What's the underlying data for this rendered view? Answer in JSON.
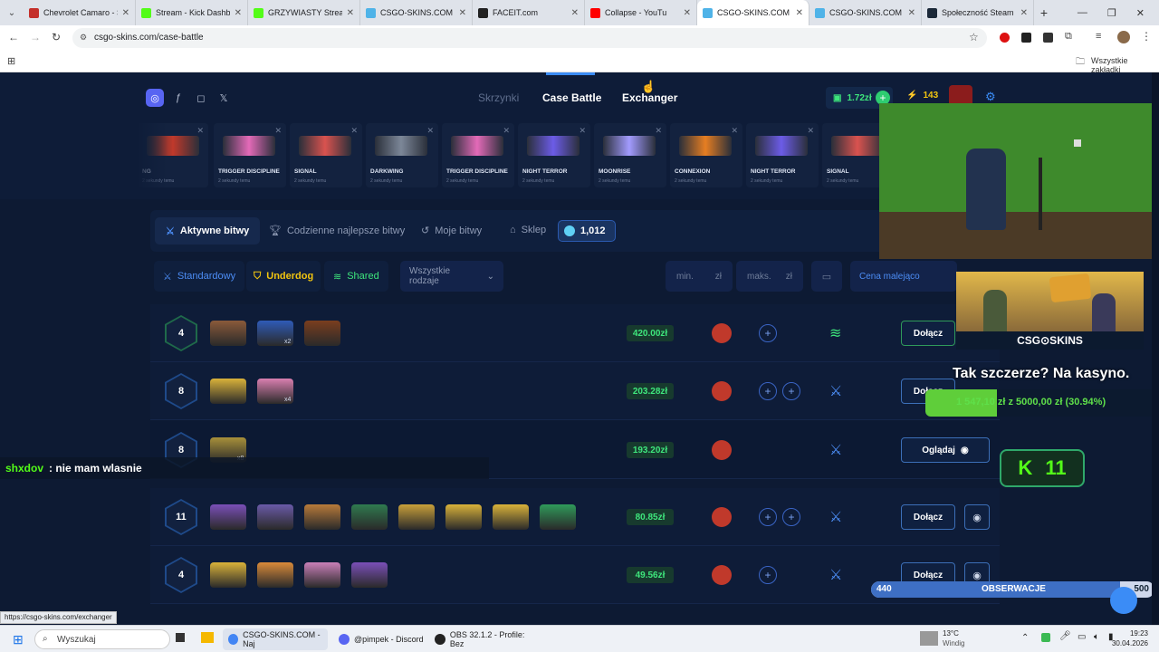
{
  "browser": {
    "tabs": [
      {
        "title": "Chevrolet Camaro - S",
        "color": "#c4302b"
      },
      {
        "title": "Stream - Kick Dashbo",
        "color": "#53fc18"
      },
      {
        "title": "GRZYWIASTY Stream",
        "color": "#53fc18"
      },
      {
        "title": "CSGO-SKINS.COM - I",
        "color": "#4fb3e8"
      },
      {
        "title": "FACEIT.com",
        "color": "#222222"
      },
      {
        "title": "Collapse - YouTu",
        "color": "#ff0000"
      },
      {
        "title": "CSGO-SKINS.COM - I",
        "color": "#4fb3e8"
      },
      {
        "title": "CSGO-SKINS.COM - I",
        "color": "#4fb3e8"
      },
      {
        "title": "Społeczność Steam",
        "color": "#1b2838"
      }
    ],
    "url": "csgo-skins.com/case-battle",
    "bookmarks_label": "Wszystkie zakładki",
    "status_url": "https://csgo-skins.com/exchanger"
  },
  "nav": {
    "links": [
      "Skrzynki",
      "Case Battle",
      "Exchanger"
    ],
    "balance": "1.72zł",
    "level": "143"
  },
  "drops": [
    {
      "name": "NG",
      "time": "2 sekundy temu",
      "color": "#c0392b"
    },
    {
      "name": "TRIGGER DISCIPLINE",
      "time": "2 sekundy temu",
      "color": "#e36ab8"
    },
    {
      "name": "SIGNAL",
      "time": "2 sekundy temu",
      "color": "#d9534f"
    },
    {
      "name": "DARKWING",
      "time": "2 sekundy temu",
      "color": "#7c8798"
    },
    {
      "name": "TRIGGER DISCIPLINE",
      "time": "2 sekundy temu",
      "color": "#e36ab8"
    },
    {
      "name": "NIGHT TERROR",
      "time": "2 sekundy temu",
      "color": "#6c5ce7"
    },
    {
      "name": "MOONRISE",
      "time": "2 sekundy temu",
      "color": "#a29bfe"
    },
    {
      "name": "CONNEXION",
      "time": "2 sekundy temu",
      "color": "#e67e22"
    },
    {
      "name": "NIGHT TERROR",
      "time": "2 sekundy temu",
      "color": "#6c5ce7"
    },
    {
      "name": "SIGNAL",
      "time": "2 sekundy temu",
      "color": "#d9534f"
    }
  ],
  "tabs": {
    "active": "Aktywne bitwy",
    "daily": "Codzienne najlepsze bitwy",
    "mine": "Moje bitwy",
    "shop": "Sklep",
    "coins": "1,012"
  },
  "filters": {
    "standard": "Standardowy",
    "underdog": "Underdog",
    "shared": "Shared",
    "all_types": "Wszystkie rodzaje",
    "min": "min.",
    "max": "maks.",
    "currency": "zł",
    "sort": "Cena malejąco"
  },
  "battles": [
    {
      "rounds": "4",
      "price": "420.00zł",
      "action": "Dołącz",
      "cases": [
        "#8a5a3a",
        "#2f5bb8",
        "#7a3e1e"
      ],
      "mult": "x2"
    },
    {
      "rounds": "8",
      "price": "203.28zł",
      "action": "Dołącz",
      "cases": [
        "#d9b23a",
        "#d97fb0"
      ],
      "mult": "x4"
    },
    {
      "rounds": "8",
      "price": "193.20zł",
      "action": "Oglądaj",
      "cases": [
        "#a8903a"
      ],
      "mult": "x8"
    },
    {
      "rounds": "11",
      "price": "80.85zł",
      "action": "Dołącz",
      "cases": [
        "#7a4fb8",
        "#6a5aa8",
        "#b87a3a",
        "#2f7a4f",
        "#c9a03a",
        "#d9b23a",
        "#d9b23a",
        "#2f9a5a"
      ],
      "mult": ""
    },
    {
      "rounds": "4",
      "price": "49.56zł",
      "action": "Dołącz",
      "cases": [
        "#d9b23a",
        "#d98a3a",
        "#c97fb8",
        "#7a4fb8"
      ],
      "mult": ""
    }
  ],
  "overlay": {
    "chat_user": "shxdov",
    "chat_msg": ": nie mam wlasnie",
    "brand": "CSG⊙SKINS",
    "headline": "Tak szczerze? Na kasyno.",
    "progress_text": "1 547,10 zł z 5000,00 zł (30.94%)",
    "progress_fraction": 0.3094,
    "kick_count": "11",
    "obs_left": "440",
    "obs_label": "OBSERWACJE",
    "obs_right": "500",
    "obs_fraction": 0.88
  },
  "taskbar": {
    "search": "Wyszukaj",
    "apps": [
      "CSGO-SKINS.COM - Naj",
      "@pimpek - Discord",
      "OBS 32.1.2 - Profile: Bez"
    ],
    "weather_temp": "13°C",
    "weather_desc": "Windig",
    "time": "19:23",
    "date": "30.04.2026"
  }
}
